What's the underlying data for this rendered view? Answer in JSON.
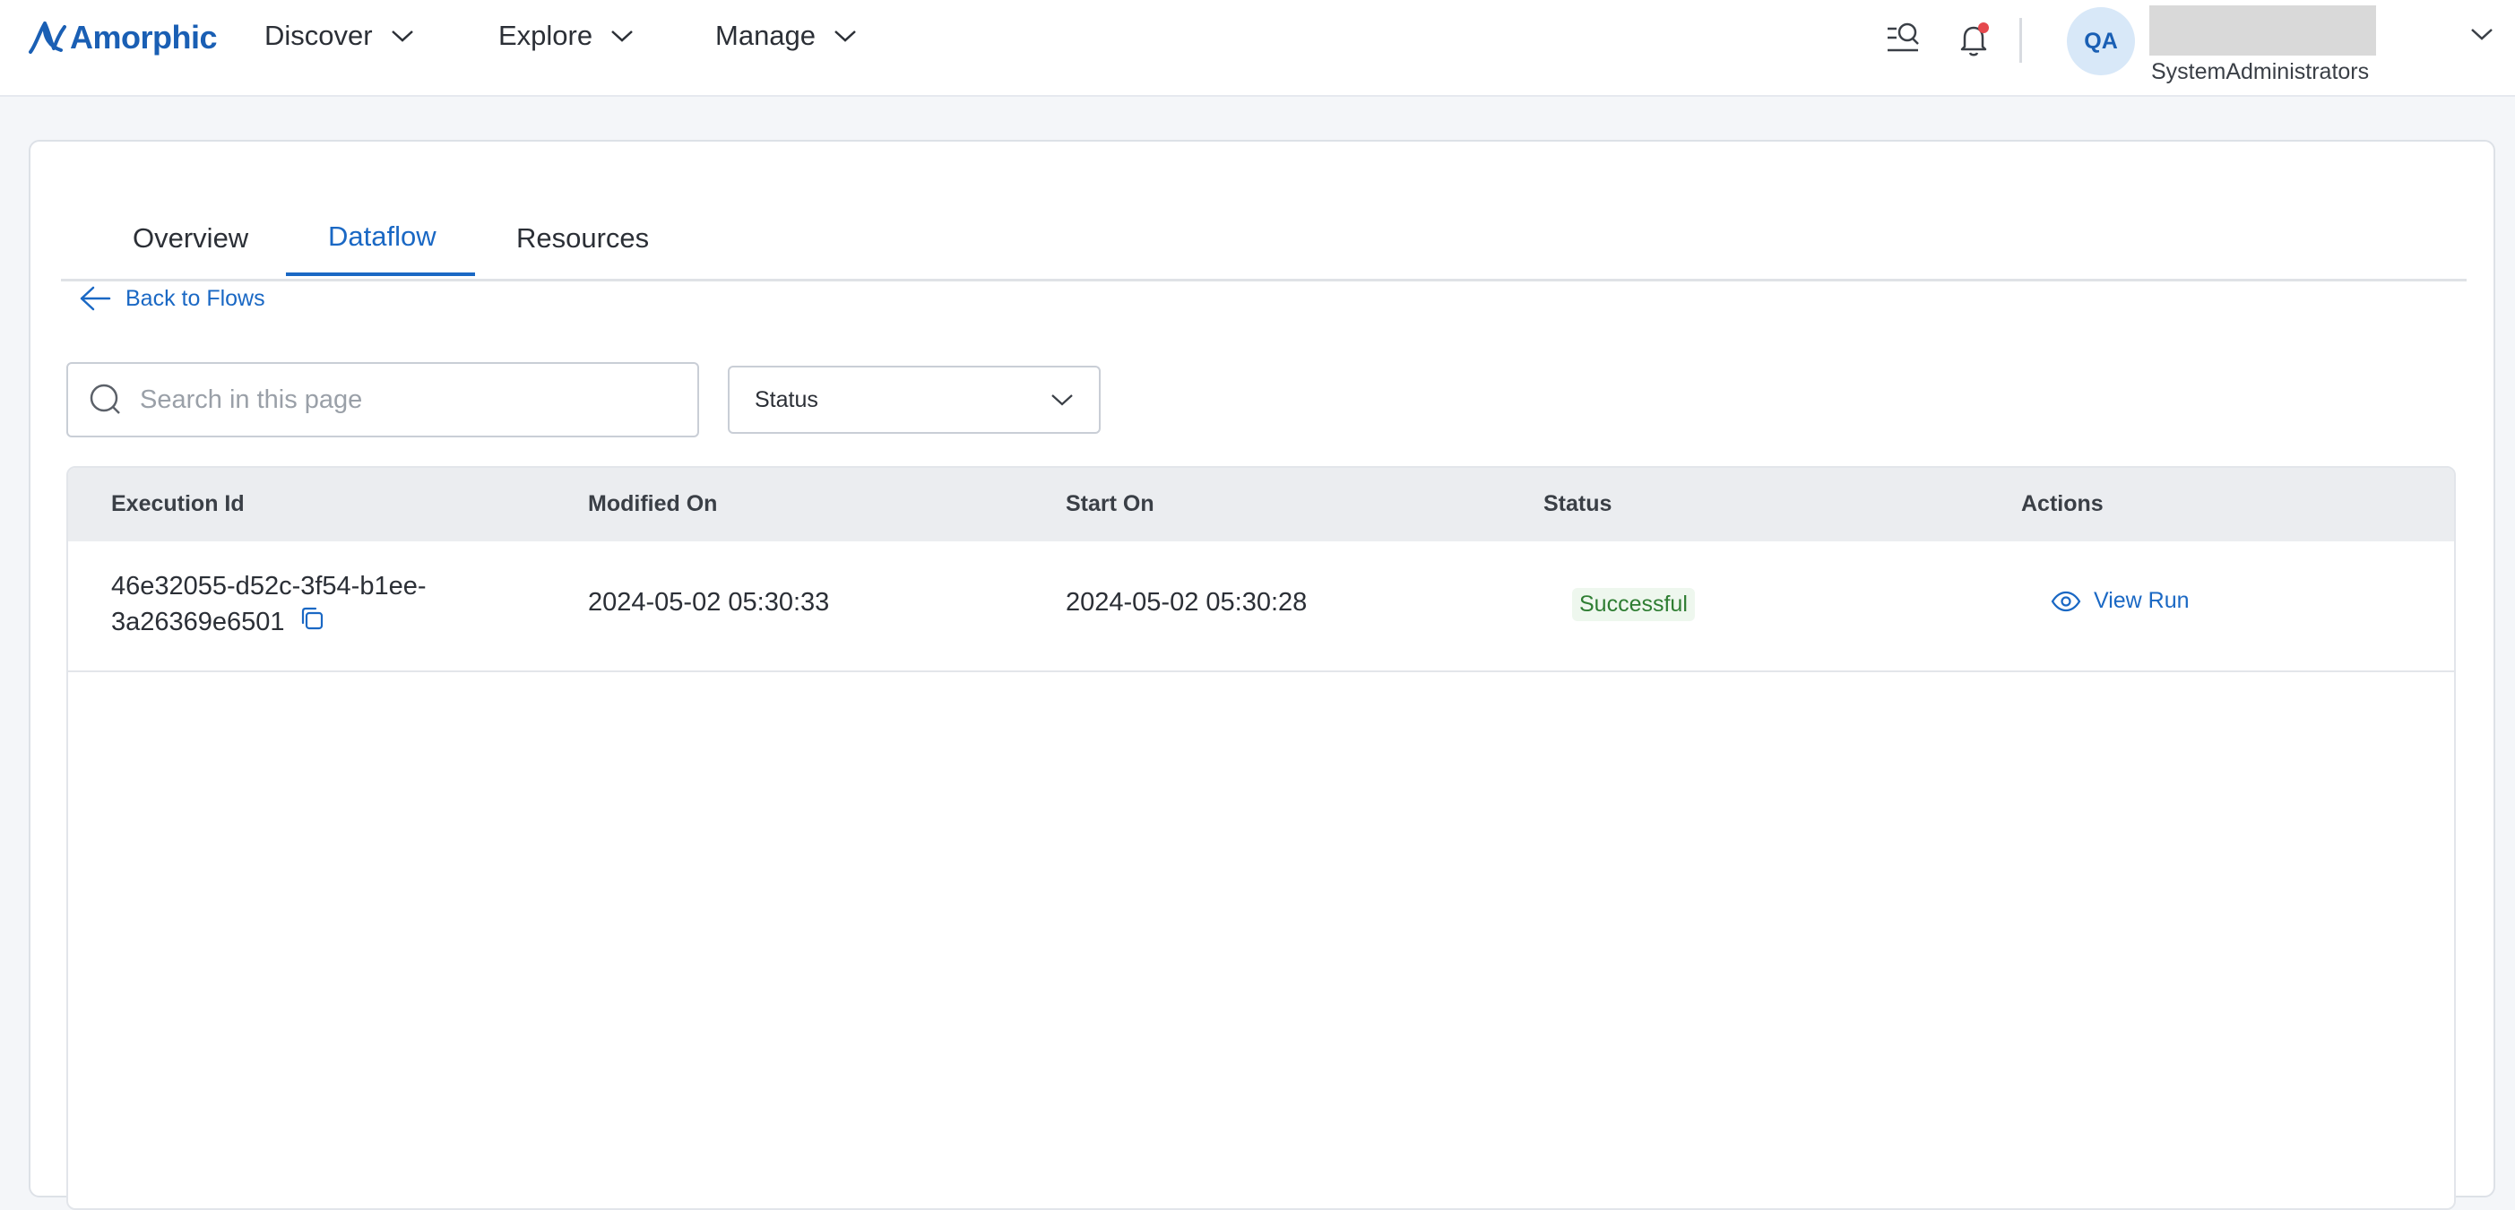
{
  "header": {
    "brand": "Amorphic",
    "nav": [
      {
        "label": "Discover"
      },
      {
        "label": "Explore"
      },
      {
        "label": "Manage"
      }
    ],
    "icons": [
      "search-list-icon",
      "bell-icon"
    ],
    "notification_dot_color": "#e5484d",
    "user": {
      "initials": "QA",
      "role": "SystemAdministrators"
    }
  },
  "tabs": [
    {
      "label": "Overview",
      "active": false
    },
    {
      "label": "Dataflow",
      "active": true
    },
    {
      "label": "Resources",
      "active": false
    }
  ],
  "back_link": {
    "label": "Back to Flows"
  },
  "search": {
    "placeholder": "Search in this page",
    "value": ""
  },
  "status_filter": {
    "label": "Status"
  },
  "table": {
    "columns": [
      "Execution Id",
      "Modified On",
      "Start On",
      "Status",
      "Actions"
    ],
    "rows": [
      {
        "execution_id_line1": "46e32055-d52c-3f54-b1ee-",
        "execution_id_line2": "3a26369e6501",
        "modified_on": "2024-05-02 05:30:33",
        "start_on": "2024-05-02 05:30:28",
        "status": "Successful",
        "action": "View Run"
      }
    ]
  },
  "colors": {
    "accent": "#1a68c4",
    "success_text": "#2e7d32",
    "success_bg": "#eef7ee"
  }
}
